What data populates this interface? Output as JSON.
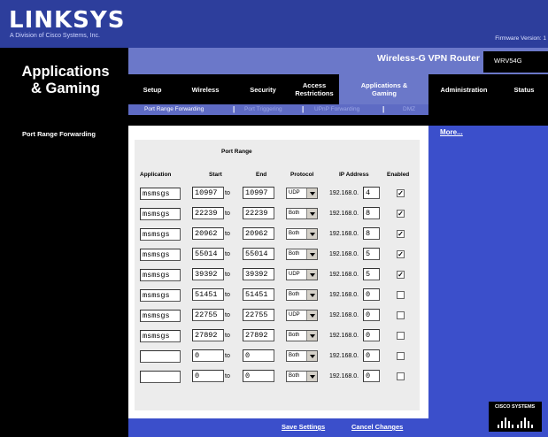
{
  "brand": {
    "logo": "LINKSYS",
    "tagline": "A Division of Cisco Systems, Inc.",
    "firmware": "Firmware Version: 1"
  },
  "page_title": "Applications & Gaming",
  "product_name": "Wireless-G VPN Router",
  "model": "WRV54G",
  "tabs": [
    {
      "label": "Setup"
    },
    {
      "label": "Wireless"
    },
    {
      "label": "Security"
    },
    {
      "label": "Access Restrictions"
    },
    {
      "label": "Applications & Gaming"
    },
    {
      "label": "Administration"
    },
    {
      "label": "Status"
    }
  ],
  "subnav": [
    {
      "label": "Port Range Forwarding"
    },
    {
      "label": "Port Triggering"
    },
    {
      "label": "UPnP Forwarding"
    },
    {
      "label": "DMZ"
    }
  ],
  "section_title": "Port Range Forwarding",
  "more_link": "More...",
  "table": {
    "group_header": "Port Range",
    "headers": {
      "application": "Application",
      "start": "Start",
      "end": "End",
      "protocol": "Protocol",
      "ip": "IP Address",
      "enabled": "Enabled"
    },
    "to_label": "to",
    "ip_prefix": "192.168.0.",
    "rows": [
      {
        "application": "msmsgs",
        "start": "10997",
        "end": "10997",
        "protocol": "UDP",
        "ip": "4",
        "enabled": true
      },
      {
        "application": "msmsgs",
        "start": "22239",
        "end": "22239",
        "protocol": "Both",
        "ip": "8",
        "enabled": true
      },
      {
        "application": "msmsgs",
        "start": "20962",
        "end": "20962",
        "protocol": "Both",
        "ip": "8",
        "enabled": true
      },
      {
        "application": "msmsgs",
        "start": "55014",
        "end": "55014",
        "protocol": "Both",
        "ip": "5",
        "enabled": true
      },
      {
        "application": "msmsgs",
        "start": "39392",
        "end": "39392",
        "protocol": "UDP",
        "ip": "5",
        "enabled": true
      },
      {
        "application": "msmsgs",
        "start": "51451",
        "end": "51451",
        "protocol": "Both",
        "ip": "0",
        "enabled": false
      },
      {
        "application": "msmsgs",
        "start": "22755",
        "end": "22755",
        "protocol": "UDP",
        "ip": "0",
        "enabled": false
      },
      {
        "application": "msmsgs",
        "start": "27892",
        "end": "27892",
        "protocol": "Both",
        "ip": "0",
        "enabled": false
      },
      {
        "application": "",
        "start": "0",
        "end": "0",
        "protocol": "Both",
        "ip": "0",
        "enabled": false
      },
      {
        "application": "",
        "start": "0",
        "end": "0",
        "protocol": "Both",
        "ip": "0",
        "enabled": false
      }
    ]
  },
  "footer": {
    "save": "Save Settings",
    "cancel": "Cancel Changes"
  },
  "cisco_logo": "CISCO SYSTEMS",
  "colors": {
    "header_blue": "#2d3e9c",
    "nav_lavender": "#6b78c9",
    "side_blue": "#3b4fcb",
    "table_bg": "#ececec"
  }
}
